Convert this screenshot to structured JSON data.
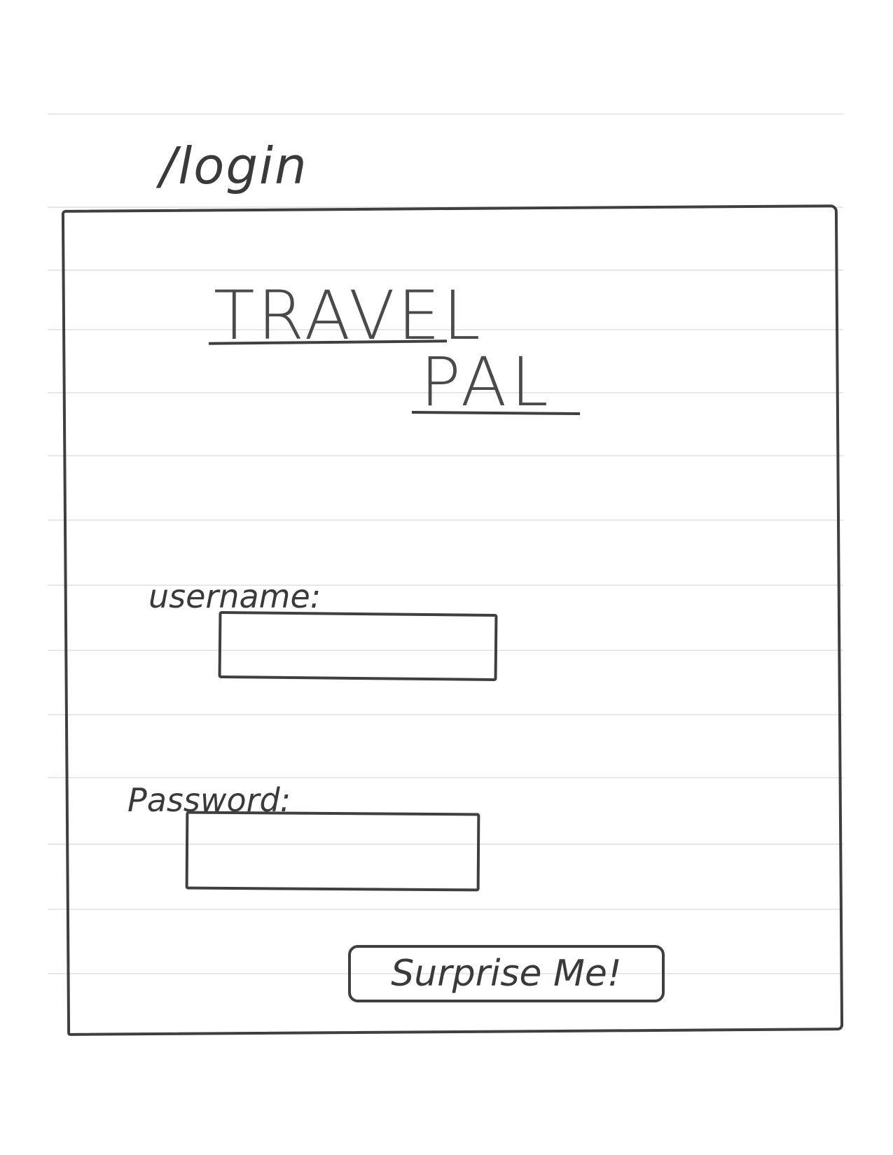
{
  "route": {
    "path": "/login"
  },
  "app": {
    "title_line1": "TRAVEL",
    "title_line2": "PAL"
  },
  "form": {
    "username_label": "username:",
    "username_value": "",
    "password_label": "Password:",
    "password_value": "",
    "submit_label": "Surprise Me!"
  }
}
